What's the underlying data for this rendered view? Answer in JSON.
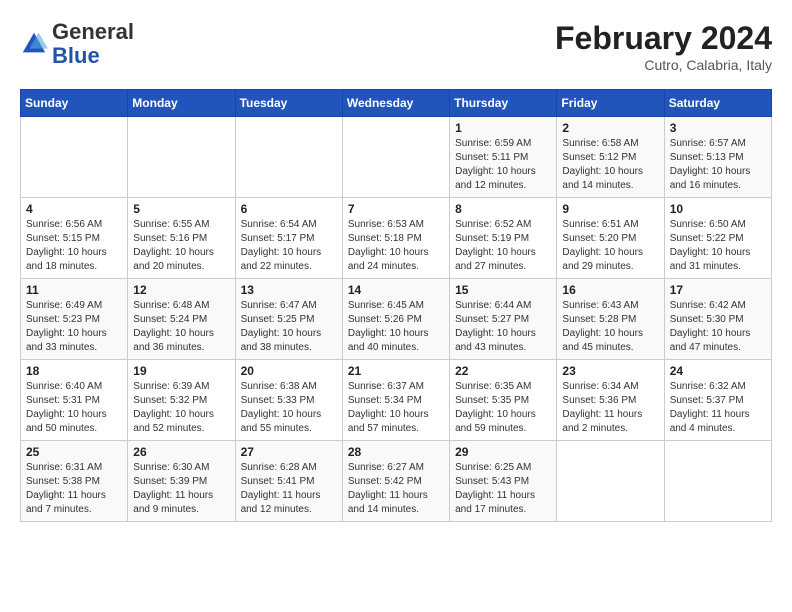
{
  "header": {
    "logo_general": "General",
    "logo_blue": "Blue",
    "month_year": "February 2024",
    "location": "Cutro, Calabria, Italy"
  },
  "days_of_week": [
    "Sunday",
    "Monday",
    "Tuesday",
    "Wednesday",
    "Thursday",
    "Friday",
    "Saturday"
  ],
  "weeks": [
    [
      {
        "day": "",
        "info": ""
      },
      {
        "day": "",
        "info": ""
      },
      {
        "day": "",
        "info": ""
      },
      {
        "day": "",
        "info": ""
      },
      {
        "day": "1",
        "info": "Sunrise: 6:59 AM\nSunset: 5:11 PM\nDaylight: 10 hours\nand 12 minutes."
      },
      {
        "day": "2",
        "info": "Sunrise: 6:58 AM\nSunset: 5:12 PM\nDaylight: 10 hours\nand 14 minutes."
      },
      {
        "day": "3",
        "info": "Sunrise: 6:57 AM\nSunset: 5:13 PM\nDaylight: 10 hours\nand 16 minutes."
      }
    ],
    [
      {
        "day": "4",
        "info": "Sunrise: 6:56 AM\nSunset: 5:15 PM\nDaylight: 10 hours\nand 18 minutes."
      },
      {
        "day": "5",
        "info": "Sunrise: 6:55 AM\nSunset: 5:16 PM\nDaylight: 10 hours\nand 20 minutes."
      },
      {
        "day": "6",
        "info": "Sunrise: 6:54 AM\nSunset: 5:17 PM\nDaylight: 10 hours\nand 22 minutes."
      },
      {
        "day": "7",
        "info": "Sunrise: 6:53 AM\nSunset: 5:18 PM\nDaylight: 10 hours\nand 24 minutes."
      },
      {
        "day": "8",
        "info": "Sunrise: 6:52 AM\nSunset: 5:19 PM\nDaylight: 10 hours\nand 27 minutes."
      },
      {
        "day": "9",
        "info": "Sunrise: 6:51 AM\nSunset: 5:20 PM\nDaylight: 10 hours\nand 29 minutes."
      },
      {
        "day": "10",
        "info": "Sunrise: 6:50 AM\nSunset: 5:22 PM\nDaylight: 10 hours\nand 31 minutes."
      }
    ],
    [
      {
        "day": "11",
        "info": "Sunrise: 6:49 AM\nSunset: 5:23 PM\nDaylight: 10 hours\nand 33 minutes."
      },
      {
        "day": "12",
        "info": "Sunrise: 6:48 AM\nSunset: 5:24 PM\nDaylight: 10 hours\nand 36 minutes."
      },
      {
        "day": "13",
        "info": "Sunrise: 6:47 AM\nSunset: 5:25 PM\nDaylight: 10 hours\nand 38 minutes."
      },
      {
        "day": "14",
        "info": "Sunrise: 6:45 AM\nSunset: 5:26 PM\nDaylight: 10 hours\nand 40 minutes."
      },
      {
        "day": "15",
        "info": "Sunrise: 6:44 AM\nSunset: 5:27 PM\nDaylight: 10 hours\nand 43 minutes."
      },
      {
        "day": "16",
        "info": "Sunrise: 6:43 AM\nSunset: 5:28 PM\nDaylight: 10 hours\nand 45 minutes."
      },
      {
        "day": "17",
        "info": "Sunrise: 6:42 AM\nSunset: 5:30 PM\nDaylight: 10 hours\nand 47 minutes."
      }
    ],
    [
      {
        "day": "18",
        "info": "Sunrise: 6:40 AM\nSunset: 5:31 PM\nDaylight: 10 hours\nand 50 minutes."
      },
      {
        "day": "19",
        "info": "Sunrise: 6:39 AM\nSunset: 5:32 PM\nDaylight: 10 hours\nand 52 minutes."
      },
      {
        "day": "20",
        "info": "Sunrise: 6:38 AM\nSunset: 5:33 PM\nDaylight: 10 hours\nand 55 minutes."
      },
      {
        "day": "21",
        "info": "Sunrise: 6:37 AM\nSunset: 5:34 PM\nDaylight: 10 hours\nand 57 minutes."
      },
      {
        "day": "22",
        "info": "Sunrise: 6:35 AM\nSunset: 5:35 PM\nDaylight: 10 hours\nand 59 minutes."
      },
      {
        "day": "23",
        "info": "Sunrise: 6:34 AM\nSunset: 5:36 PM\nDaylight: 11 hours\nand 2 minutes."
      },
      {
        "day": "24",
        "info": "Sunrise: 6:32 AM\nSunset: 5:37 PM\nDaylight: 11 hours\nand 4 minutes."
      }
    ],
    [
      {
        "day": "25",
        "info": "Sunrise: 6:31 AM\nSunset: 5:38 PM\nDaylight: 11 hours\nand 7 minutes."
      },
      {
        "day": "26",
        "info": "Sunrise: 6:30 AM\nSunset: 5:39 PM\nDaylight: 11 hours\nand 9 minutes."
      },
      {
        "day": "27",
        "info": "Sunrise: 6:28 AM\nSunset: 5:41 PM\nDaylight: 11 hours\nand 12 minutes."
      },
      {
        "day": "28",
        "info": "Sunrise: 6:27 AM\nSunset: 5:42 PM\nDaylight: 11 hours\nand 14 minutes."
      },
      {
        "day": "29",
        "info": "Sunrise: 6:25 AM\nSunset: 5:43 PM\nDaylight: 11 hours\nand 17 minutes."
      },
      {
        "day": "",
        "info": ""
      },
      {
        "day": "",
        "info": ""
      }
    ]
  ]
}
